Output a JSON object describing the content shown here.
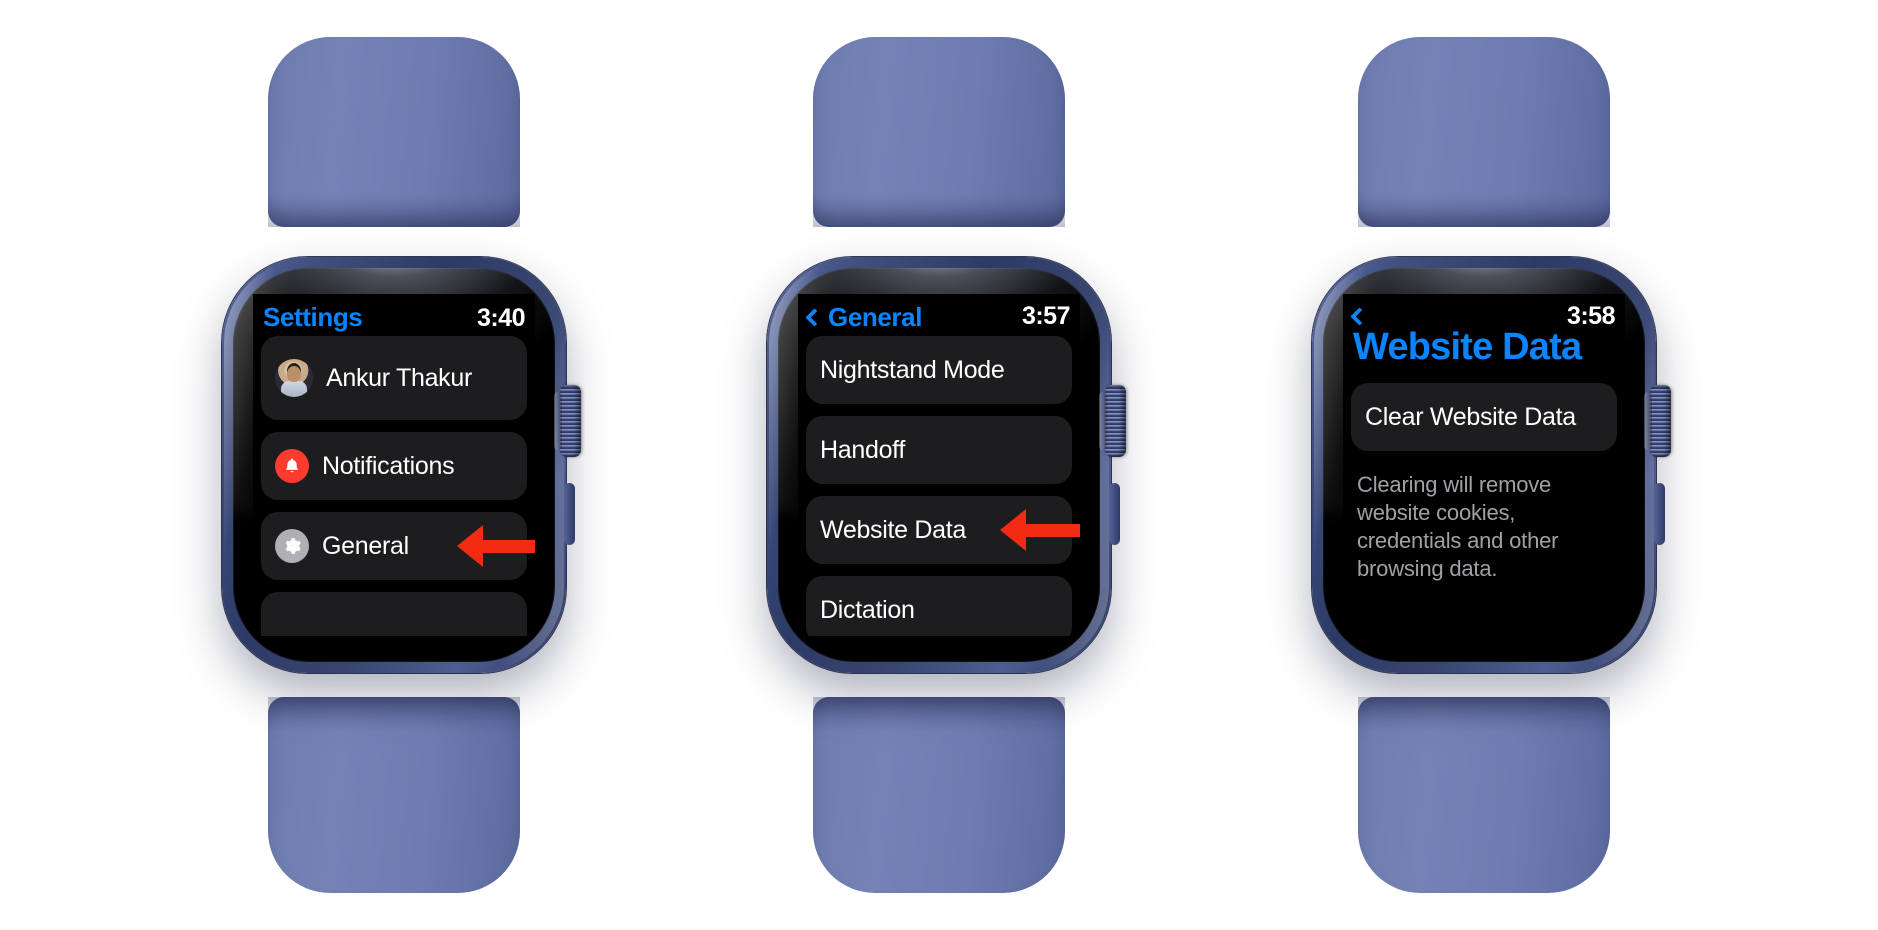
{
  "accent": {
    "blue": "#0a84ff",
    "arrow_red": "#f42a12",
    "bell_red": "#ff3b30",
    "gear_gray": "#aeb0b6",
    "row_bg": "#1d1d1f",
    "band_blue": "#6d7cb0"
  },
  "watches": [
    {
      "id": "watch-settings",
      "status": {
        "title": "Settings",
        "time": "3:40",
        "back": false
      },
      "rows": [
        {
          "label": "Ankur Thakur",
          "icon": "avatar",
          "tall": true,
          "arrow": false
        },
        {
          "label": "Notifications",
          "icon": "bell-icon",
          "tall": false,
          "arrow": false
        },
        {
          "label": "General",
          "icon": "gear-icon",
          "tall": false,
          "arrow": true
        }
      ]
    },
    {
      "id": "watch-general",
      "status": {
        "title": "General",
        "time": "3:57",
        "back": true
      },
      "rows": [
        {
          "label": "Nightstand Mode",
          "icon": "none",
          "tall": false,
          "arrow": false
        },
        {
          "label": "Handoff",
          "icon": "none",
          "tall": false,
          "arrow": false
        },
        {
          "label": "Website Data",
          "icon": "none",
          "tall": false,
          "arrow": true
        },
        {
          "label": "Dictation",
          "icon": "none",
          "tall": false,
          "arrow": false
        }
      ]
    },
    {
      "id": "watch-website-data",
      "status": {
        "title": "",
        "time": "3:58",
        "back": true
      },
      "page_title": "Website Data",
      "rows": [
        {
          "label": "Clear Website Data",
          "icon": "none",
          "tall": false,
          "arrow": false
        }
      ],
      "hint": "Clearing will remove website cookies, credentials and other browsing data."
    }
  ]
}
